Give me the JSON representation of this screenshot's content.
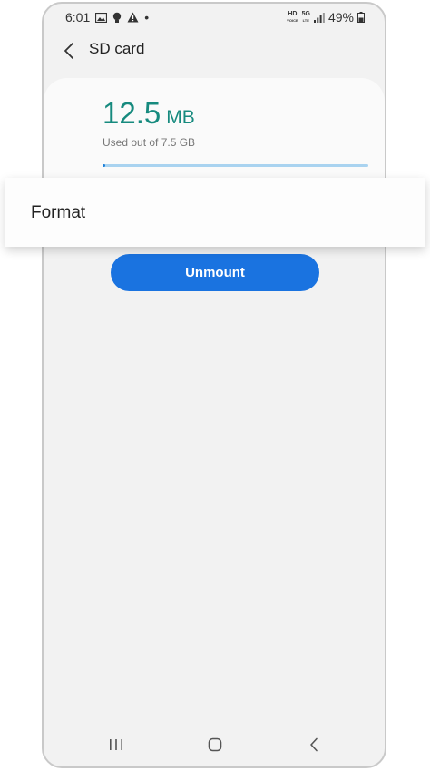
{
  "status_bar": {
    "time": "6:01",
    "hd_label_top": "HD",
    "hd_label_bottom": "VOICE",
    "network_label_top": "5G",
    "network_label_bottom": "LTE",
    "battery": "49%",
    "dot": "•"
  },
  "app_bar": {
    "title": "SD card"
  },
  "storage": {
    "used_number": "12.5",
    "used_unit": "MB",
    "caption": "Used out of 7.5 GB",
    "used_fraction": 0.0017
  },
  "actions": {
    "unmount_label": "Unmount"
  },
  "popup_menu": {
    "items": [
      "Format"
    ]
  },
  "colors": {
    "accent_teal": "#168a7e",
    "primary_blue": "#1a73e0",
    "progress_track": "#a9d3f0"
  }
}
